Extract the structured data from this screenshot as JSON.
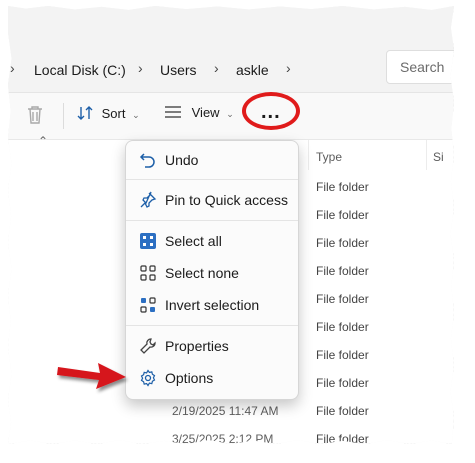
{
  "breadcrumb": {
    "items": [
      "Local Disk (C:)",
      "Users",
      "askle"
    ]
  },
  "search": {
    "placeholder": "Search"
  },
  "toolbar": {
    "sort_label": "Sort",
    "view_label": "View",
    "more_label": "..."
  },
  "columns": {
    "type": "Type",
    "size": "Si"
  },
  "rows": {
    "types": [
      "File folder",
      "File folder",
      "File folder",
      "File folder",
      "File folder",
      "File folder",
      "File folder",
      "File folder",
      "File folder"
    ],
    "dates": [
      "2/19/2025 11:47 AM",
      "3/25/2025 2:12 PM"
    ]
  },
  "menu": {
    "items": [
      {
        "label": "Undo",
        "icon": "undo-icon"
      },
      {
        "label": "Pin to Quick access",
        "icon": "pin-icon"
      },
      {
        "label": "Select all",
        "icon": "select-all-icon"
      },
      {
        "label": "Select none",
        "icon": "select-none-icon"
      },
      {
        "label": "Invert selection",
        "icon": "invert-selection-icon"
      },
      {
        "label": "Properties",
        "icon": "wrench-icon"
      },
      {
        "label": "Options",
        "icon": "gear-icon"
      }
    ]
  },
  "colors": {
    "accent": "#0067c0",
    "highlight_circle": "#e01b1b",
    "arrow": "#d6141b"
  }
}
